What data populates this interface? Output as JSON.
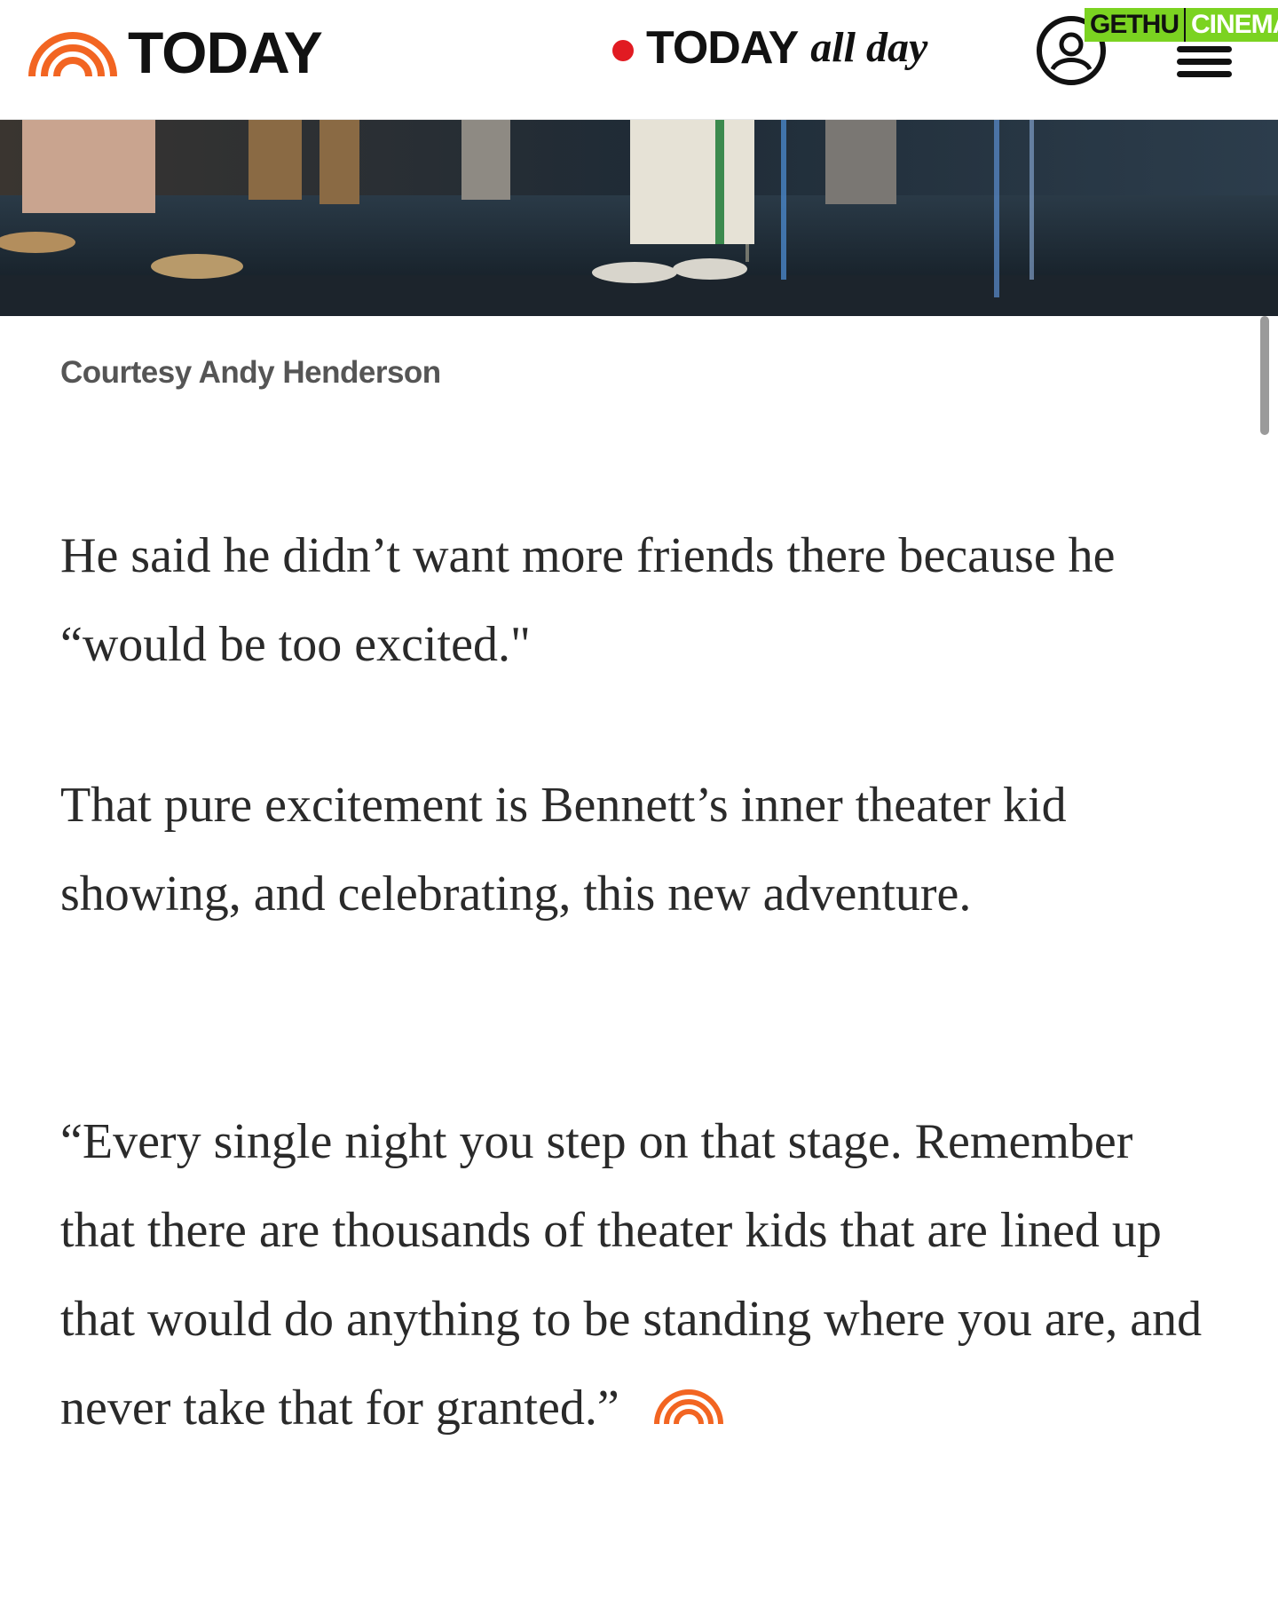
{
  "header": {
    "logo_text": "TODAY",
    "allday_today": "TODAY",
    "allday_suffix": "all day",
    "icons": [
      "today-rainbow-icon",
      "live-dot-icon",
      "account-icon",
      "menu-icon"
    ]
  },
  "watermark": {
    "part1": "GETHU",
    "part2": "CINEMA"
  },
  "hero": {
    "alt": "stage performers"
  },
  "caption": "Courtesy Andy Henderson",
  "article": {
    "paragraphs": [
      "He said he didn’t want more friends there because he “would be too excited.\"",
      "That pure excitement is Bennett’s inner theater kid showing, and celebrating, this new adventure.",
      "“Every single night you step on that stage. Remember that there are thousands of theater kids that are lined up that would do anything to be standing where you are, and never take that for granted.”"
    ]
  },
  "colors": {
    "brand_orange": "#f26522",
    "live_red": "#e11b22",
    "watermark_green": "#7bd321"
  }
}
